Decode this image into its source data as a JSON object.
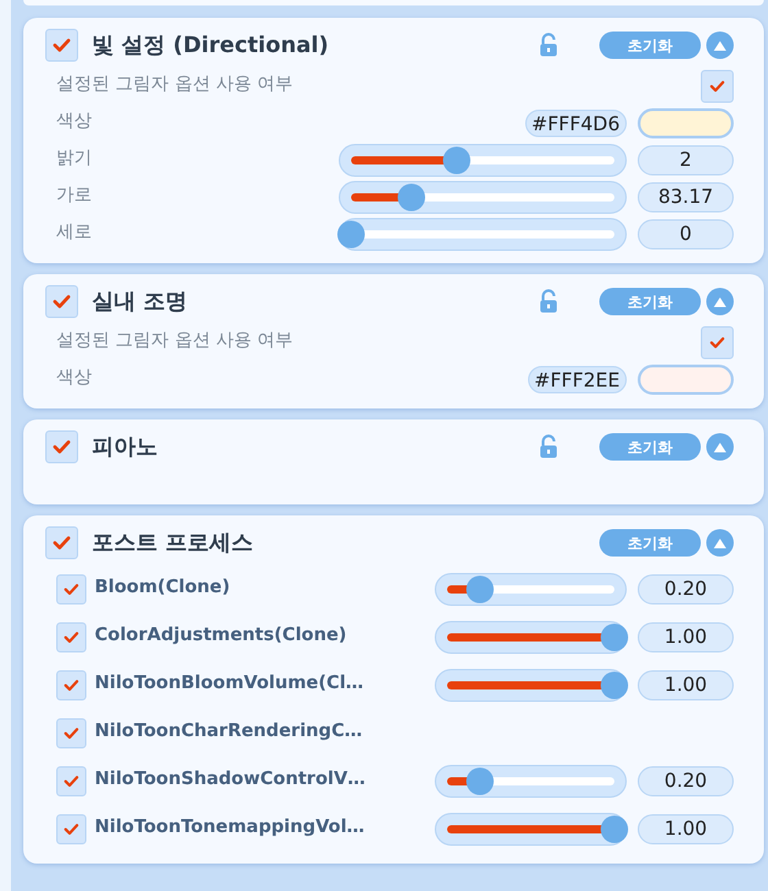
{
  "cards": [
    {
      "title": "빛 설정 (Directional)",
      "checked": true,
      "lock_shown": true,
      "reset_label": "초기화",
      "expanded": true,
      "items": [
        {
          "kind": "checkbox",
          "label": "설정된 그림자 옵션 사용 여부",
          "checked": true
        },
        {
          "kind": "color",
          "label": "색상",
          "value": "#FFF4D6"
        },
        {
          "kind": "slider",
          "label": "밝기",
          "level": 0.4,
          "reading": "2"
        },
        {
          "kind": "slider",
          "label": "가로",
          "level": 0.23,
          "reading": "83.17"
        },
        {
          "kind": "slider",
          "label": "세로",
          "level": 0,
          "reading": "0"
        }
      ]
    },
    {
      "title": "실내 조명",
      "checked": true,
      "lock_shown": true,
      "reset_label": "초기화",
      "expanded": true,
      "items": [
        {
          "kind": "checkbox",
          "label": "설정된 그림자 옵션 사용 여부",
          "checked": true
        },
        {
          "kind": "color",
          "label": "색상",
          "value": "#FFF2EE"
        }
      ]
    },
    {
      "title": "피아노",
      "checked": true,
      "lock_shown": true,
      "reset_label": "초기화",
      "expanded": true
    },
    {
      "title": "포스트 프로세스",
      "checked": true,
      "lock_shown": false,
      "reset_label": "초기화",
      "expanded": true,
      "items": [
        {
          "kind": "effect",
          "label": "Bloom(Clone)",
          "checked": true,
          "level": 0.2,
          "reading": "0.20"
        },
        {
          "kind": "effect",
          "label": "ColorAdjustments(Clone)",
          "checked": true,
          "level": 1,
          "reading": "1.00"
        },
        {
          "kind": "effect",
          "label": "NiloToonBloomVolume(Cl…",
          "checked": true,
          "level": 1,
          "reading": "1.00"
        },
        {
          "kind": "effect",
          "label": "NiloToonCharRenderingC…",
          "checked": true
        },
        {
          "kind": "effect",
          "label": "NiloToonShadowControlV…",
          "checked": true,
          "level": 0.2,
          "reading": "0.20"
        },
        {
          "kind": "effect",
          "label": "NiloToonTonemappingVol…",
          "checked": true,
          "level": 1,
          "reading": "1.00"
        }
      ]
    }
  ]
}
